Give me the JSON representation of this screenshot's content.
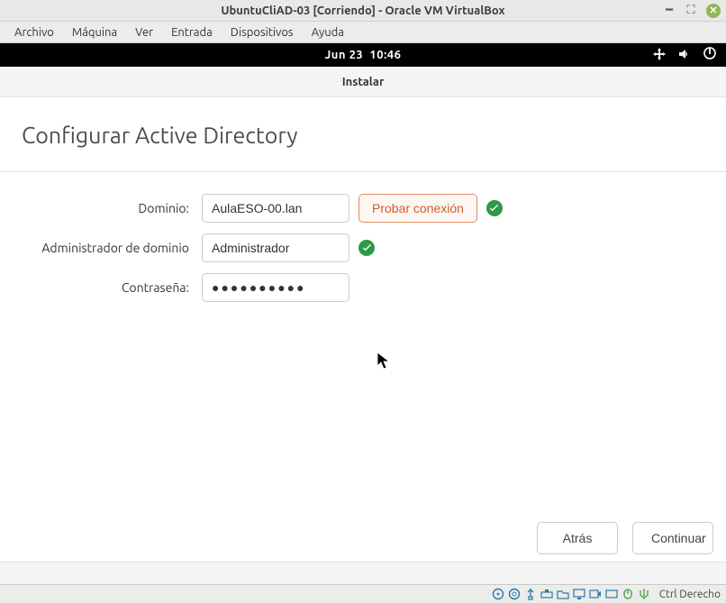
{
  "host": {
    "title": "UbuntuCliAD-03 [Corriendo] - Oracle VM VirtualBox",
    "menu": {
      "archivo": "Archivo",
      "maquina": "Máquina",
      "ver": "Ver",
      "entrada": "Entrada",
      "dispositivos": "Dispositivos",
      "ayuda": "Ayuda"
    },
    "capture_key": "Ctrl Derecho"
  },
  "guest": {
    "date_label": "Jun 23",
    "time_label": "10:46"
  },
  "installer": {
    "header": "Instalar",
    "title": "Configurar Active Directory",
    "labels": {
      "domain": "Dominio:",
      "admin": "Administrador de dominio",
      "password": "Contraseña:"
    },
    "values": {
      "domain": "AulaESO-00.lan",
      "admin": "Administrador",
      "password": "●●●●●●●●●●"
    },
    "buttons": {
      "test_connection": "Probar conexión",
      "back": "Atrás",
      "continue": "Continuar"
    }
  }
}
